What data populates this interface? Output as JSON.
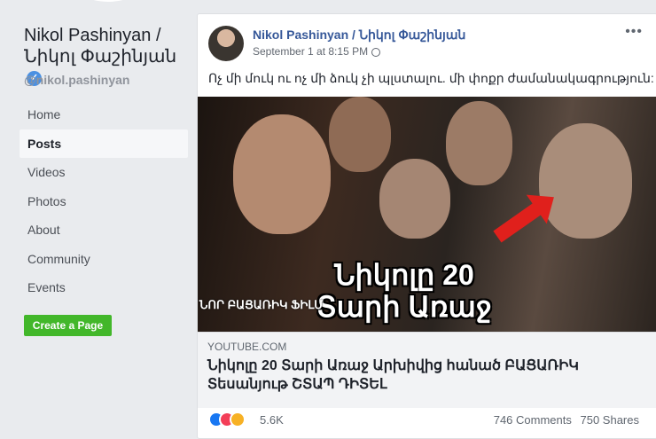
{
  "sidebar": {
    "page_name": "Nikol Pashinyan / Նիկոլ Փաշինյան",
    "handle": "@nikol.pashinyan",
    "nav": [
      {
        "label": "Home",
        "active": false
      },
      {
        "label": "Posts",
        "active": true
      },
      {
        "label": "Videos",
        "active": false
      },
      {
        "label": "Photos",
        "active": false
      },
      {
        "label": "About",
        "active": false
      },
      {
        "label": "Community",
        "active": false
      },
      {
        "label": "Events",
        "active": false
      }
    ],
    "create_page_label": "Create a Page"
  },
  "post": {
    "author": "Nikol Pashinyan / Նիկոլ Փաշինյան",
    "timestamp": "September 1 at 8:15 PM",
    "more": "•••",
    "text": "Ոչ մի մուկ ու ոչ մի ձուկ չի պլստալու. մի փոքր ժամանակագրություն:",
    "thumbnail": {
      "title": "Նիկոլը 20 Տարի Առաջ",
      "corner_text": "ՆՈՐ ԲԱՑԱՌԻԿ ՖԻԼՄ"
    },
    "link": {
      "domain": "YOUTUBE.COM",
      "title": "Նիկոլը 20 Տարի Առաջ Արխիվից հանած ԲԱՑԱՌԻԿ Տեսանյութ ՇՏԱՊ ԴԻՏԵԼ"
    },
    "reactions_count": "5.6K",
    "comments": "746 Comments",
    "shares": "750 Shares"
  },
  "colors": {
    "link_blue": "#365899",
    "create_green": "#42b72a",
    "background": "#e9ebee"
  },
  "icons": [
    "verified-badge-icon",
    "globe-icon",
    "more-options-icon",
    "like-reaction-icon",
    "love-reaction-icon",
    "haha-reaction-icon"
  ]
}
